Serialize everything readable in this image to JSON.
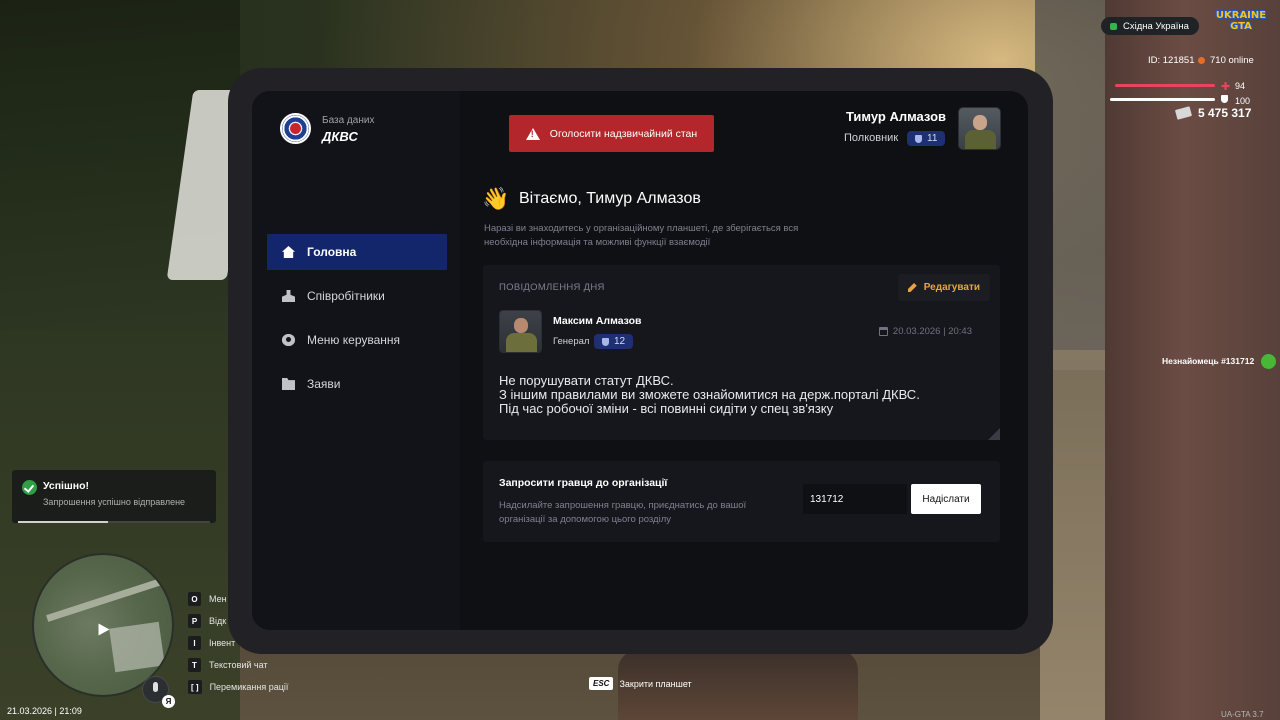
{
  "tablet": {
    "db_label": "База даних",
    "db_name": "ДКВС",
    "emergency_button": "Оголосити надзвичайний стан",
    "user": {
      "name": "Тимур Алмазов",
      "rank": "Полковник",
      "level": "11"
    },
    "nav": [
      {
        "label": "Головна",
        "icon": "home-icon",
        "active": true
      },
      {
        "label": "Співробітники",
        "icon": "users-icon",
        "active": false
      },
      {
        "label": "Меню керування",
        "icon": "gear-icon",
        "active": false
      },
      {
        "label": "Заяви",
        "icon": "folder-icon",
        "active": false
      }
    ],
    "welcome": {
      "emoji": "👋",
      "title": "Вітаємо, Тимур Алмазов",
      "description": "Наразі ви знаходитесь у організаційному планшеті, де зберігається вся необхідна інформація та можливі функції взаємодії"
    },
    "motd": {
      "title": "ПОВІДОМЛЕННЯ ДНЯ",
      "edit_button": "Редагувати",
      "author_name": "Максим Алмазов",
      "author_rank": "Генерал",
      "author_level": "12",
      "date": "20.03.2026 | 20:43",
      "text": "Не порушувати статут ДКВС.\nЗ іншим правилами ви зможете ознайомитися на держ.порталі ДКВС.\nПід час робочої зміни - всі повинні сидіти у спец зв'язку"
    },
    "invite": {
      "title": "Запросити гравця до організації",
      "description": "Надсилайте запрошення гравцю, приєднатись до вашої організації за допомогою цього розділу",
      "input_value": "131712",
      "send_button": "Надіслати"
    }
  },
  "hud": {
    "region": "Східна Україна",
    "game_logo": "UKRAINE GTA",
    "player_id": "ID: 121851",
    "online": "710 online",
    "health": "94",
    "armor": "100",
    "money": "5 475 317",
    "stranger_label": "Незнайомець #131712",
    "voice_key": "Я",
    "toast": {
      "title": "Успішно!",
      "text": "Запрошення успішно відправлене",
      "progress": 0.47
    },
    "keys": [
      {
        "key": "O",
        "label": "Мен"
      },
      {
        "key": "P",
        "label": "Відк"
      },
      {
        "key": "I",
        "label": "Інвент"
      },
      {
        "key": "T",
        "label": "Текстовий чат"
      },
      {
        "key": "[ ]",
        "label": "Перемикання рації"
      }
    ],
    "esc_key": "ESC",
    "esc_label": "Закрити планшет",
    "datetime": "21.03.2026 | 21:09",
    "version": "UA-GTA 3.7"
  },
  "colors": {
    "accent_blue": "#14266b",
    "emergency_red": "#b3262c",
    "edit_orange": "#e9a441",
    "success_green": "#2f9e44"
  }
}
